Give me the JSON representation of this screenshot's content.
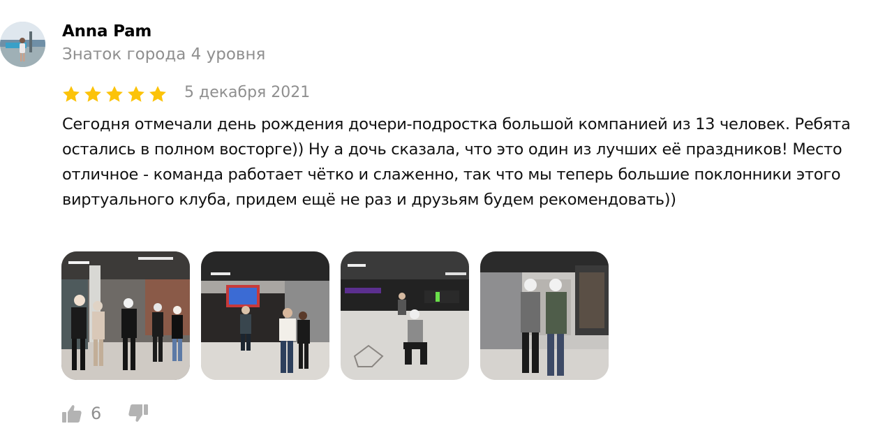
{
  "author": {
    "name": "Anna Pam",
    "level": "Знаток города 4 уровня",
    "avatar_icon": "avatar-photo"
  },
  "review": {
    "rating": 5,
    "rating_max": 5,
    "star_color": "#fcc30a",
    "date": "5 декабря 2021",
    "text": "Сегодня отмечали день рождения дочери-подростка большой компанией из 13 человек. Ребята остались в полном восторге)) Ну а дочь сказала, что это один из лучших её праздников! Место отличное - команда работает чётко и слаженно, так что мы теперь большие поклонники этого виртуального клуба, придем ещё не раз и друзьям будем рекомендовать))"
  },
  "photos": [
    {
      "icon": "photo-vr-group"
    },
    {
      "icon": "photo-vr-screen"
    },
    {
      "icon": "photo-vr-arena"
    },
    {
      "icon": "photo-vr-players"
    }
  ],
  "reactions": {
    "like_icon": "thumbs-up-icon",
    "like_count": "6",
    "dislike_icon": "thumbs-down-icon",
    "icon_color": "#b3b3b3"
  }
}
